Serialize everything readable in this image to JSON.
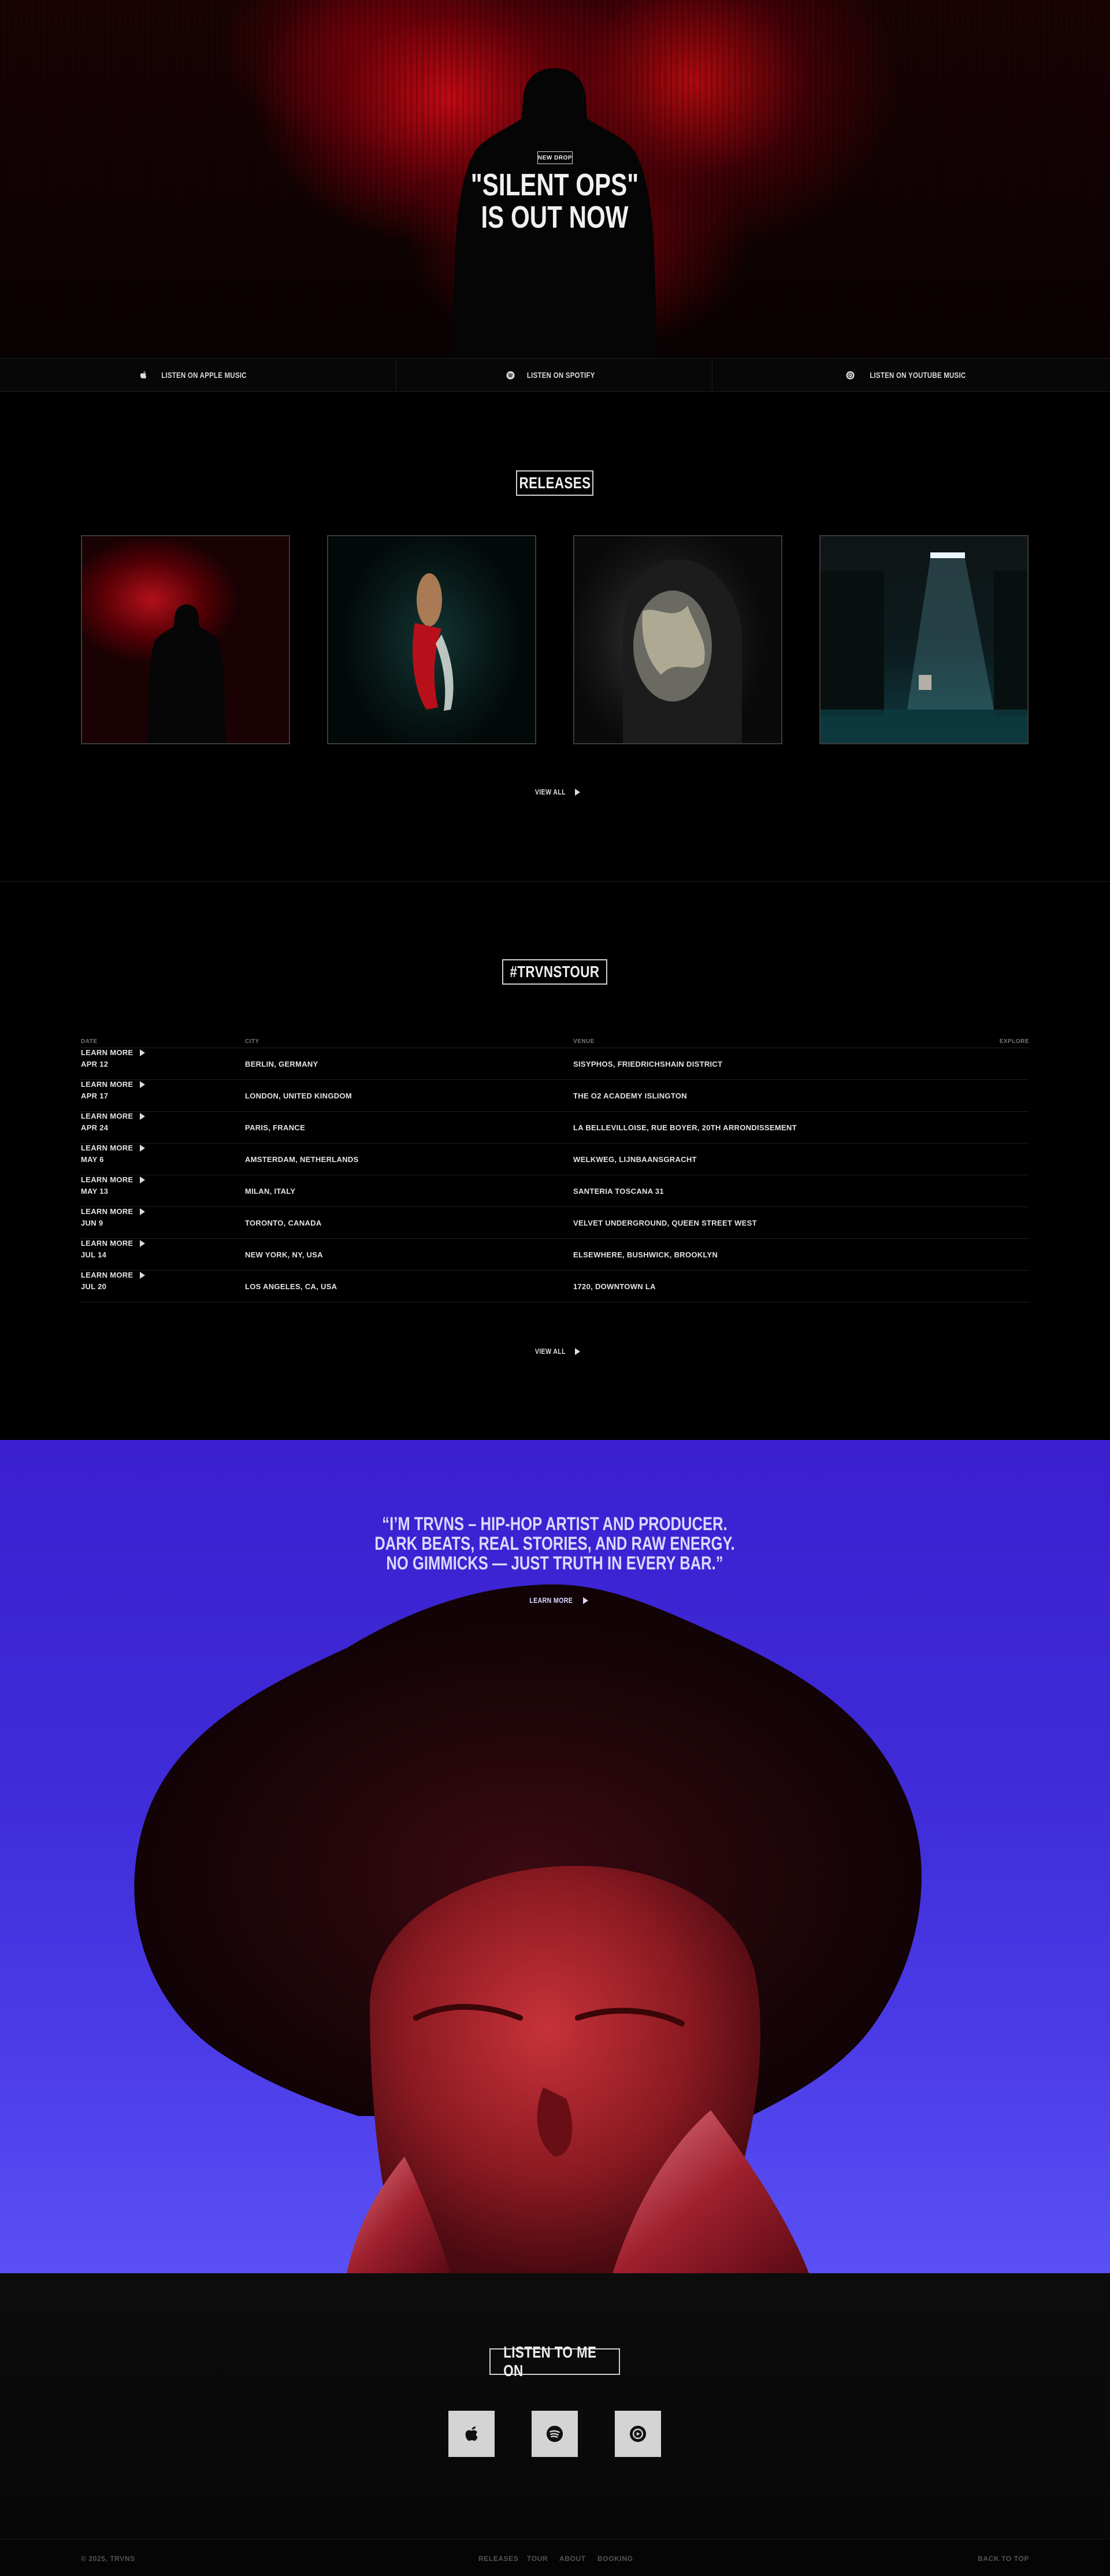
{
  "hero": {
    "badge": "NEW DROP",
    "title_line1": "\"SILENT OPS\"",
    "title_line2": "IS OUT NOW"
  },
  "listen_bar": [
    {
      "label": "LISTEN ON APPLE MUSIC",
      "icon": "apple-icon"
    },
    {
      "label": "LISTEN ON SPOTIFY",
      "icon": "spotify-icon"
    },
    {
      "label": "LISTEN ON YOUTUBE MUSIC",
      "icon": "youtube-music-icon"
    }
  ],
  "releases": {
    "heading": "RELEASES",
    "view_all": "VIEW ALL"
  },
  "tour": {
    "heading": "#TRVNSTOUR",
    "columns": {
      "date": "DATE",
      "city": "CITY",
      "venue": "VENUE",
      "explore": "EXPLORE"
    },
    "rows": [
      {
        "date": "APR 12",
        "city": "BERLIN, GERMANY",
        "venue": "SISYPHOS, FRIEDRICHSHAIN DISTRICT",
        "action": "LEARN MORE"
      },
      {
        "date": "APR 17",
        "city": "LONDON, UNITED KINGDOM",
        "venue": "THE O2 ACADEMY ISLINGTON",
        "action": "LEARN MORE"
      },
      {
        "date": "APR 24",
        "city": "PARIS, FRANCE",
        "venue": "LA BELLEVILLOISE, RUE BOYER, 20TH ARRONDISSEMENT",
        "action": "LEARN MORE"
      },
      {
        "date": "MAY 6",
        "city": "AMSTERDAM, NETHERLANDS",
        "venue": "WELKWEG, LIJNBAANSGRACHT",
        "action": "LEARN MORE"
      },
      {
        "date": "MAY 13",
        "city": "MILAN, ITALY",
        "venue": "SANTERIA TOSCANA 31",
        "action": "LEARN MORE"
      },
      {
        "date": "JUN 9",
        "city": "TORONTO, CANADA",
        "venue": "VELVET UNDERGROUND, QUEEN STREET WEST",
        "action": "LEARN MORE"
      },
      {
        "date": "JUL 14",
        "city": "NEW YORK, NY, USA",
        "venue": "ELSEWHERE, BUSHWICK, BROOKLYN",
        "action": "LEARN MORE"
      },
      {
        "date": "JUL 20",
        "city": "LOS ANGELES, CA, USA",
        "venue": "1720, DOWNTOWN LA",
        "action": "LEARN MORE"
      }
    ],
    "view_all": "VIEW ALL"
  },
  "about": {
    "quote_line1": "“I’M TRVNS – HIP-HOP ARTIST AND PRODUCER.",
    "quote_line2": "DARK BEATS, REAL STORIES, AND RAW ENERGY.",
    "quote_line3": "NO GIMMICKS — JUST TRUTH IN EVERY BAR.”",
    "learn_more": "LEARN MORE"
  },
  "listen": {
    "heading": "LISTEN TO ME ON",
    "services": [
      "apple-icon",
      "spotify-icon",
      "youtube-music-icon"
    ]
  },
  "footer": {
    "copyright": "© 2025, TRVNS",
    "nav": [
      "RELEASES",
      "TOUR",
      "ABOUT",
      "BOOKING"
    ],
    "back_to_top": "BACK TO TOP"
  },
  "colors": {
    "hero_red": "#c00a14",
    "about_blue": "#3f2bd8",
    "text": "#e8e8e8"
  }
}
